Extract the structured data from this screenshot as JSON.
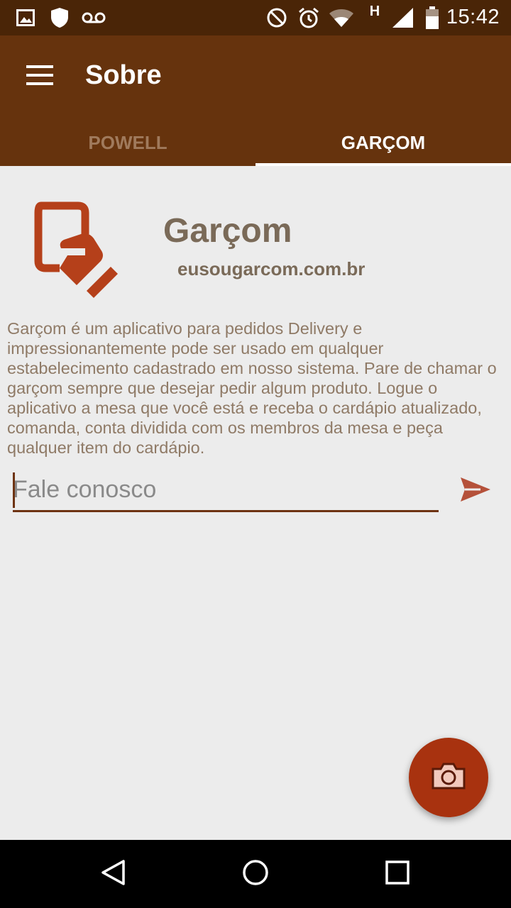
{
  "status_bar": {
    "time": "15:42",
    "icons": [
      "image-icon",
      "shield-icon",
      "voicemail-icon",
      "do-not-disturb-icon",
      "alarm-icon",
      "wifi-icon",
      "h-network-icon",
      "signal-icon",
      "battery-icon"
    ],
    "network_label": "H"
  },
  "app_bar": {
    "title": "Sobre",
    "background": "#66330d"
  },
  "tabs": [
    {
      "label": "POWELL",
      "selected": false
    },
    {
      "label": "GARÇOM",
      "selected": true
    }
  ],
  "about": {
    "app_name": "Garçom",
    "site": "eusougarcom.com.br",
    "description": "Garçom é um aplicativo para pedidos Delivery e impressionantemente pode ser usado em qualquer estabelecimento cadastrado em nosso sistema. Pare de chamar o garçom sempre que desejar pedir algum produto. Logue o aplicativo a mesa que você está e receba o cardápio atualizado, comanda, conta dividida com os membros da mesa e peça qualquer item do cardápio."
  },
  "contact": {
    "placeholder": "Fale conosco",
    "value": ""
  },
  "colors": {
    "accent": "#a8320f",
    "status_bar": "#4a2507"
  }
}
